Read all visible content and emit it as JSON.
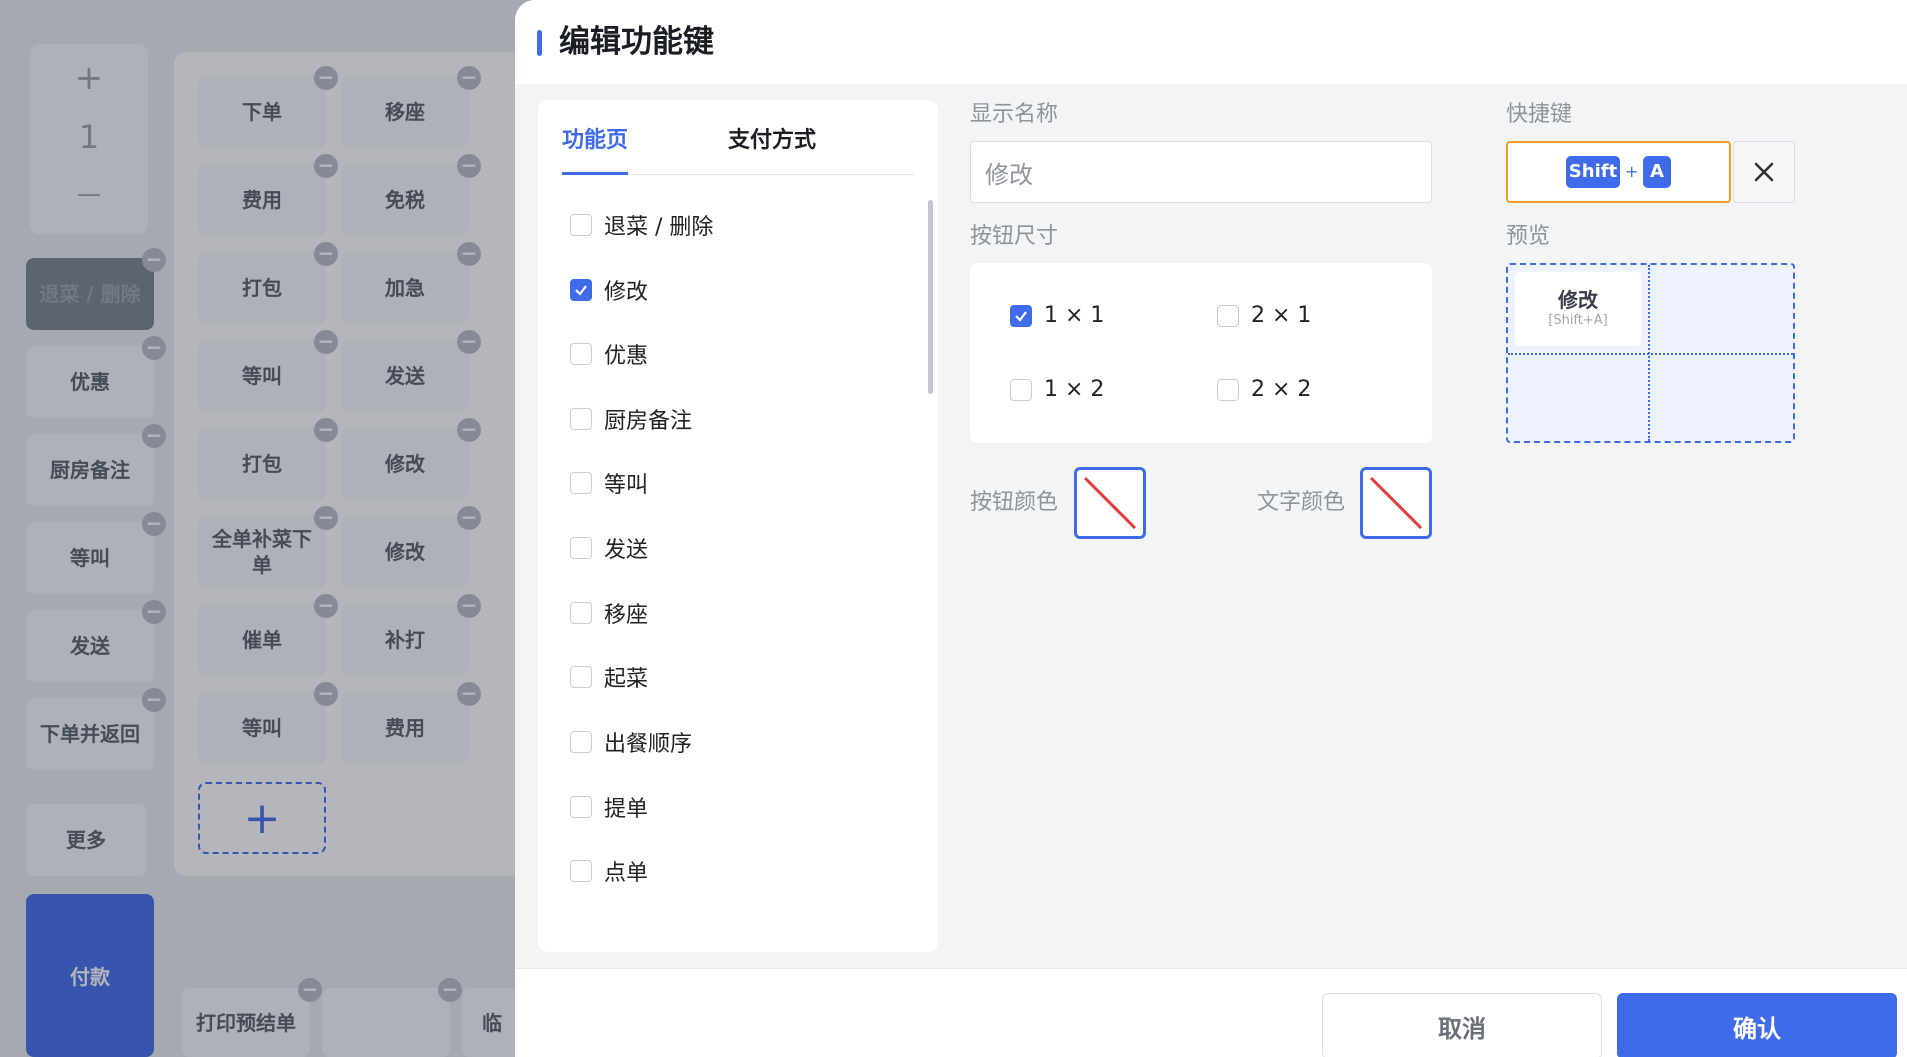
{
  "background": {
    "qty": {
      "plus": "+",
      "value": "1",
      "minus": "—"
    },
    "left_tiles": [
      "退菜 / 删除",
      "优惠",
      "厨房备注",
      "等叫",
      "发送",
      "下单并返回",
      "更多"
    ],
    "pay_label": "付款",
    "grid_col1": [
      "下单",
      "费用",
      "打包",
      "等叫",
      "打包",
      "全单补菜下单",
      "催单",
      "等叫"
    ],
    "grid_col2": [
      "移座",
      "免税",
      "加急",
      "发送",
      "修改",
      "修改",
      "补打",
      "费用"
    ],
    "bottom_tiles": [
      "打印预结单",
      "",
      "临"
    ],
    "add_icon": "+"
  },
  "drawer": {
    "title": "编辑功能键",
    "tabs": [
      {
        "label": "功能页",
        "active": true
      },
      {
        "label": "支付方式",
        "active": false
      }
    ],
    "functions": [
      {
        "label": "退菜 / 删除",
        "checked": false
      },
      {
        "label": "修改",
        "checked": true
      },
      {
        "label": "优惠",
        "checked": false
      },
      {
        "label": "厨房备注",
        "checked": false
      },
      {
        "label": "等叫",
        "checked": false
      },
      {
        "label": "发送",
        "checked": false
      },
      {
        "label": "移座",
        "checked": false
      },
      {
        "label": "起菜",
        "checked": false
      },
      {
        "label": "出餐顺序",
        "checked": false
      },
      {
        "label": "提单",
        "checked": false
      },
      {
        "label": "点单",
        "checked": false
      }
    ],
    "display_name": {
      "label": "显示名称",
      "value": "修改"
    },
    "button_size": {
      "label": "按钮尺寸",
      "options": [
        {
          "label": "1 × 1",
          "checked": true
        },
        {
          "label": "2 × 1",
          "checked": false
        },
        {
          "label": "1 × 2",
          "checked": false
        },
        {
          "label": "2 × 2",
          "checked": false
        }
      ]
    },
    "button_color": {
      "label": "按钮颜色",
      "value": "none"
    },
    "text_color": {
      "label": "文字颜色",
      "value": "none"
    },
    "shortcut": {
      "label": "快捷键",
      "keys": [
        "Shift",
        "A"
      ],
      "joiner": "+"
    },
    "preview": {
      "label": "预览",
      "name": "修改",
      "hint": "[Shift+A]"
    },
    "footer": {
      "cancel": "取消",
      "confirm": "确认"
    }
  },
  "colors": {
    "accent": "#3f6be8",
    "focus": "#f0a020",
    "no_color_slash": "#e03a3a"
  }
}
